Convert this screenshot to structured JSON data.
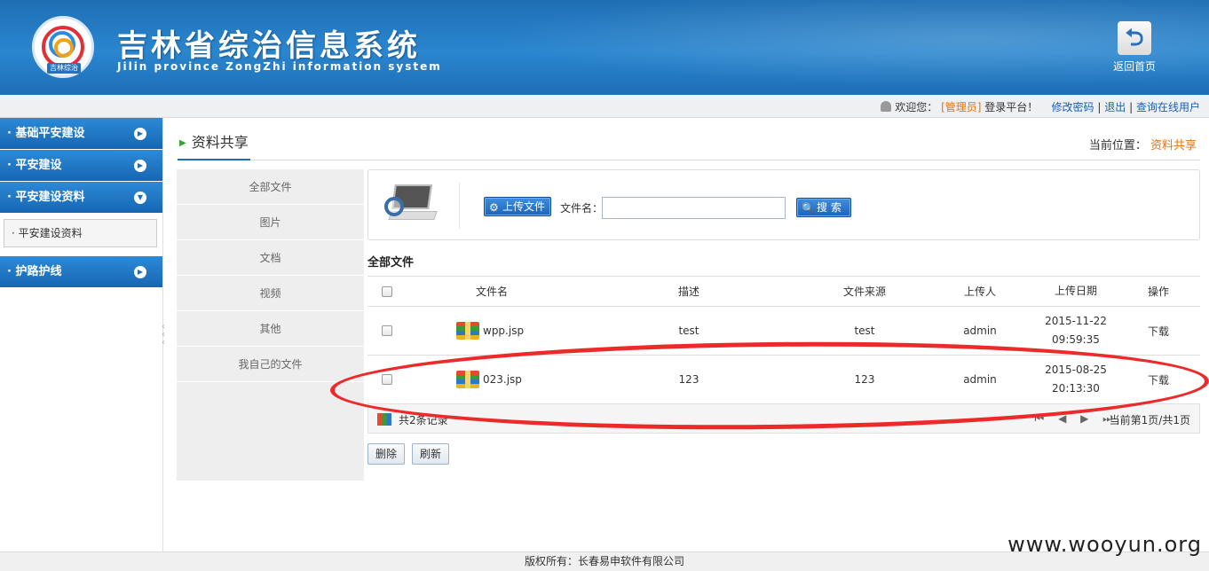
{
  "header": {
    "title": "吉林省综治信息系统",
    "subtitle": "Jilin province ZongZhi information system",
    "logo_text": "吉林综治",
    "home_label": "返回首页"
  },
  "userbar": {
    "welcome": "欢迎您：",
    "role": "[管理员]",
    "login_text": "登录平台！",
    "change_password": "修改密码",
    "sep1": "|",
    "logout": "退出",
    "sep2": "|",
    "online_users": "查询在线用户"
  },
  "sidebar": {
    "items": [
      {
        "label": "· 基础平安建设",
        "arrow": "▶"
      },
      {
        "label": "· 平安建设",
        "arrow": "▶"
      },
      {
        "label": "· 平安建设资料",
        "arrow": "▼"
      },
      {
        "label": "· 护路护线",
        "arrow": "▶"
      }
    ],
    "sub_items": [
      {
        "label": "· 平安建设资料"
      }
    ]
  },
  "page": {
    "tab_title": "资料共享",
    "location_label": "当前位置：",
    "location_current": "资料共享"
  },
  "categories": [
    "全部文件",
    "图片",
    "文档",
    "视频",
    "其他",
    "我自己的文件"
  ],
  "toolbar": {
    "upload_label": "上传文件",
    "filename_label": "文件名：",
    "filename_value": "",
    "search_label": "搜索"
  },
  "list_title": "全部文件",
  "table": {
    "headers": {
      "name": "文件名",
      "desc": "描述",
      "source": "文件来源",
      "uploader": "上传人",
      "date": "上传日期",
      "action": "操作"
    },
    "rows": [
      {
        "name": "wpp.jsp",
        "desc": "test",
        "source": "test",
        "uploader": "admin",
        "date": "2015-11-22",
        "time": "09:59:35",
        "action": "下载"
      },
      {
        "name": "023.jsp",
        "desc": "123",
        "source": "123",
        "uploader": "admin",
        "date": "2015-08-25",
        "time": "20:13:30",
        "action": "下载"
      }
    ]
  },
  "pager": {
    "count_text": "共2条记录",
    "nav_glyphs": "⏮ ◀ ▶ ⏭",
    "page_info": "当前第1页/共1页"
  },
  "actions": {
    "delete_label": "删除",
    "refresh_label": "刷新"
  },
  "footer": {
    "copyright": "版权所有：长春易申软件有限公司"
  },
  "watermark": "www.wooyun.org",
  "colors": {
    "header_blue": "#1f6fb5",
    "accent_orange": "#e8730a",
    "link_blue": "#1a5fb4",
    "annotation_red": "#ec2a2a"
  }
}
